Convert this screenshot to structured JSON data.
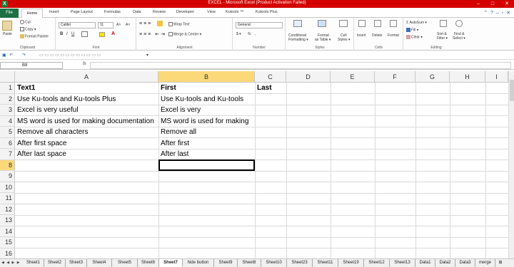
{
  "window": {
    "title": "EXCEL - Microsoft Excel (Product Activation Failed)",
    "app_icon": "X",
    "controls": [
      "–",
      "□",
      "✕"
    ]
  },
  "ribbon_tabs": [
    "File",
    "Home",
    "Insert",
    "Page Layout",
    "Formulas",
    "Data",
    "Review",
    "Developer",
    "View",
    "Kutools ™",
    "Kutools Plus"
  ],
  "ribbon": {
    "clipboard": {
      "paste": "Paste",
      "cut": "Cut",
      "copy": "Copy ▾",
      "format_painter": "Format Painter",
      "label": "Clipboard"
    },
    "font": {
      "name": "Calibri",
      "size": "11",
      "grow": "A˄",
      "shrink": "A˅",
      "label": "Font"
    },
    "alignment": {
      "wrap": "Wrap Text",
      "merge": "Merge & Center ▾",
      "label": "Alignment"
    },
    "number": {
      "format": "General",
      "currency": "$ ▾",
      "percent": "%",
      "comma": ",",
      "label": "Number"
    },
    "styles": {
      "conditional": "Conditional",
      "conditional2": "Formatting ▾",
      "format_table": "Format",
      "format_table2": "as Table ▾",
      "cell_styles": "Cell",
      "cell_styles2": "Styles ▾",
      "label": "Styles"
    },
    "cells": {
      "insert": "Insert",
      "delete": "Delete",
      "format": "Format",
      "label": "Cells"
    },
    "editing": {
      "autosum": "Σ AutoSum ▾",
      "fill": "Fill ▾",
      "clear": "Clear ▾",
      "sort": "Sort &",
      "sort2": "Filter ▾",
      "find": "Find &",
      "find2": "Select ▾",
      "label": "Editing"
    }
  },
  "formula_bar": {
    "name_box": "B8",
    "fx": "fx",
    "value": ""
  },
  "columns": [
    "A",
    "B",
    "C",
    "D",
    "E",
    "F",
    "G",
    "H",
    "I"
  ],
  "rows": [
    "1",
    "2",
    "3",
    "4",
    "5",
    "6",
    "7",
    "8",
    "9",
    "10",
    "11",
    "12",
    "13",
    "14",
    "15",
    "16"
  ],
  "cells": {
    "A1": "Text1",
    "B1": "First",
    "C1": "Last",
    "A2": "Use Ku-tools and Ku-tools Plus",
    "B2": "Use Ku-tools and Ku-tools",
    "A3": "Excel is very useful",
    "B3": "Excel is very",
    "A4": "MS word is used for making documentation",
    "B4": "MS word is used for making",
    "A5": "Remove all characters",
    "B5": "Remove all",
    "A6": "After first space",
    "B6": "After first",
    "A7": "After last space",
    "B7": "After last"
  },
  "sheet_nav": "◀ ◀ ▶ ▶",
  "sheets": [
    "Sheet1",
    "Sheet2",
    "Sheet3",
    "Sheet4",
    "Sheet5",
    "Sheet6",
    "Sheet7",
    "hide button",
    "Sheet9",
    "Sheet8",
    "Sheet10",
    "Sheet23",
    "Sheet11",
    "Sheet19",
    "Sheet12",
    "Sheet13",
    "Data1",
    "Data2",
    "Data3",
    "merge"
  ],
  "active_sheet": "Sheet7",
  "colors": {
    "title_bar": "#d40000",
    "file_tab": "#1e7145",
    "selected_header": "#fbd979"
  }
}
